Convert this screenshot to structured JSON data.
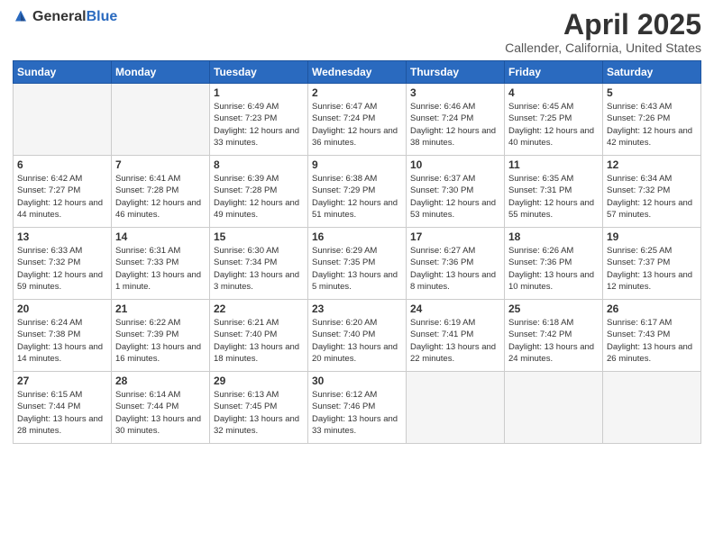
{
  "header": {
    "logo_general": "General",
    "logo_blue": "Blue",
    "title": "April 2025",
    "subtitle": "Callender, California, United States"
  },
  "days_of_week": [
    "Sunday",
    "Monday",
    "Tuesday",
    "Wednesday",
    "Thursday",
    "Friday",
    "Saturday"
  ],
  "weeks": [
    [
      {
        "day": "",
        "empty": true
      },
      {
        "day": "",
        "empty": true
      },
      {
        "day": "1",
        "sunrise": "6:49 AM",
        "sunset": "7:23 PM",
        "daylight": "12 hours and 33 minutes."
      },
      {
        "day": "2",
        "sunrise": "6:47 AM",
        "sunset": "7:24 PM",
        "daylight": "12 hours and 36 minutes."
      },
      {
        "day": "3",
        "sunrise": "6:46 AM",
        "sunset": "7:24 PM",
        "daylight": "12 hours and 38 minutes."
      },
      {
        "day": "4",
        "sunrise": "6:45 AM",
        "sunset": "7:25 PM",
        "daylight": "12 hours and 40 minutes."
      },
      {
        "day": "5",
        "sunrise": "6:43 AM",
        "sunset": "7:26 PM",
        "daylight": "12 hours and 42 minutes."
      }
    ],
    [
      {
        "day": "6",
        "sunrise": "6:42 AM",
        "sunset": "7:27 PM",
        "daylight": "12 hours and 44 minutes."
      },
      {
        "day": "7",
        "sunrise": "6:41 AM",
        "sunset": "7:28 PM",
        "daylight": "12 hours and 46 minutes."
      },
      {
        "day": "8",
        "sunrise": "6:39 AM",
        "sunset": "7:28 PM",
        "daylight": "12 hours and 49 minutes."
      },
      {
        "day": "9",
        "sunrise": "6:38 AM",
        "sunset": "7:29 PM",
        "daylight": "12 hours and 51 minutes."
      },
      {
        "day": "10",
        "sunrise": "6:37 AM",
        "sunset": "7:30 PM",
        "daylight": "12 hours and 53 minutes."
      },
      {
        "day": "11",
        "sunrise": "6:35 AM",
        "sunset": "7:31 PM",
        "daylight": "12 hours and 55 minutes."
      },
      {
        "day": "12",
        "sunrise": "6:34 AM",
        "sunset": "7:32 PM",
        "daylight": "12 hours and 57 minutes."
      }
    ],
    [
      {
        "day": "13",
        "sunrise": "6:33 AM",
        "sunset": "7:32 PM",
        "daylight": "12 hours and 59 minutes."
      },
      {
        "day": "14",
        "sunrise": "6:31 AM",
        "sunset": "7:33 PM",
        "daylight": "13 hours and 1 minute."
      },
      {
        "day": "15",
        "sunrise": "6:30 AM",
        "sunset": "7:34 PM",
        "daylight": "13 hours and 3 minutes."
      },
      {
        "day": "16",
        "sunrise": "6:29 AM",
        "sunset": "7:35 PM",
        "daylight": "13 hours and 5 minutes."
      },
      {
        "day": "17",
        "sunrise": "6:27 AM",
        "sunset": "7:36 PM",
        "daylight": "13 hours and 8 minutes."
      },
      {
        "day": "18",
        "sunrise": "6:26 AM",
        "sunset": "7:36 PM",
        "daylight": "13 hours and 10 minutes."
      },
      {
        "day": "19",
        "sunrise": "6:25 AM",
        "sunset": "7:37 PM",
        "daylight": "13 hours and 12 minutes."
      }
    ],
    [
      {
        "day": "20",
        "sunrise": "6:24 AM",
        "sunset": "7:38 PM",
        "daylight": "13 hours and 14 minutes."
      },
      {
        "day": "21",
        "sunrise": "6:22 AM",
        "sunset": "7:39 PM",
        "daylight": "13 hours and 16 minutes."
      },
      {
        "day": "22",
        "sunrise": "6:21 AM",
        "sunset": "7:40 PM",
        "daylight": "13 hours and 18 minutes."
      },
      {
        "day": "23",
        "sunrise": "6:20 AM",
        "sunset": "7:40 PM",
        "daylight": "13 hours and 20 minutes."
      },
      {
        "day": "24",
        "sunrise": "6:19 AM",
        "sunset": "7:41 PM",
        "daylight": "13 hours and 22 minutes."
      },
      {
        "day": "25",
        "sunrise": "6:18 AM",
        "sunset": "7:42 PM",
        "daylight": "13 hours and 24 minutes."
      },
      {
        "day": "26",
        "sunrise": "6:17 AM",
        "sunset": "7:43 PM",
        "daylight": "13 hours and 26 minutes."
      }
    ],
    [
      {
        "day": "27",
        "sunrise": "6:15 AM",
        "sunset": "7:44 PM",
        "daylight": "13 hours and 28 minutes."
      },
      {
        "day": "28",
        "sunrise": "6:14 AM",
        "sunset": "7:44 PM",
        "daylight": "13 hours and 30 minutes."
      },
      {
        "day": "29",
        "sunrise": "6:13 AM",
        "sunset": "7:45 PM",
        "daylight": "13 hours and 32 minutes."
      },
      {
        "day": "30",
        "sunrise": "6:12 AM",
        "sunset": "7:46 PM",
        "daylight": "13 hours and 33 minutes."
      },
      {
        "day": "",
        "empty": true
      },
      {
        "day": "",
        "empty": true
      },
      {
        "day": "",
        "empty": true
      }
    ]
  ]
}
